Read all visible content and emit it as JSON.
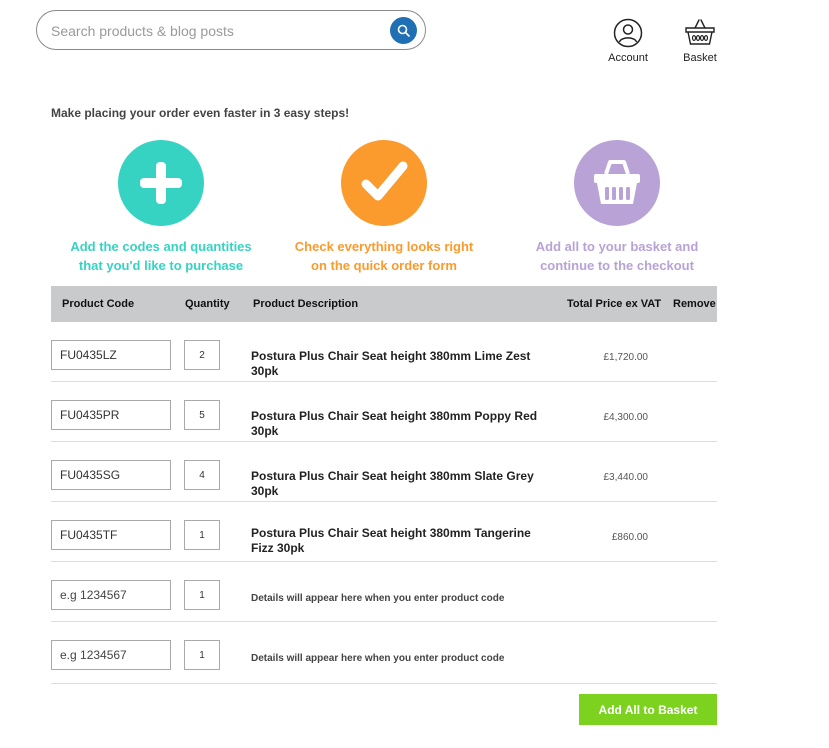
{
  "search": {
    "placeholder": "Search products & blog posts",
    "icon": "search-icon"
  },
  "header": {
    "account_label": "Account",
    "basket_label": "Basket"
  },
  "steps": {
    "heading": "Make placing your order even faster in 3 easy steps!",
    "items": [
      {
        "line1": "Add the codes and quantities",
        "line2": "that you'd like to purchase",
        "color": "#36d3c3",
        "icon": "plus-icon"
      },
      {
        "line1": "Check everything looks right",
        "line2": "on the quick order form",
        "color": "#fb9a2d",
        "icon": "checkmark-icon"
      },
      {
        "line1": "Add all to your basket and",
        "line2": "continue to the checkout",
        "color": "#b8a2d6",
        "icon": "basket-icon"
      }
    ]
  },
  "table": {
    "headers": {
      "code": "Product Code",
      "qty": "Quantity",
      "desc": "Product Description",
      "total": "Total Price ex VAT",
      "remove": "Remove"
    },
    "rows": [
      {
        "code": "FU0435LZ",
        "qty": "2",
        "desc": "Postura Plus Chair Seat height 380mm Lime Zest 30pk",
        "price": "£1,720.00"
      },
      {
        "code": "FU0435PR",
        "qty": "5",
        "desc": "Postura Plus Chair Seat height 380mm Poppy Red 30pk",
        "price": "£4,300.00"
      },
      {
        "code": "FU0435SG",
        "qty": "4",
        "desc": "Postura Plus Chair Seat height 380mm Slate Grey 30pk",
        "price": "£3,440.00"
      },
      {
        "code": "FU0435TF",
        "qty": "1",
        "desc": "Postura Plus Chair Seat height 380mm Tangerine Fizz 30pk",
        "price": "£860.00"
      },
      {
        "code_placeholder": "e.g 1234567",
        "qty": "1",
        "desc": "Details will appear here when you enter product code"
      },
      {
        "code_placeholder": "e.g 1234567",
        "qty": "1",
        "desc": "Details will appear here when you enter product code"
      }
    ]
  },
  "actions": {
    "add_all_label": "Add All to Basket",
    "add_all_color": "#7dd21f"
  }
}
